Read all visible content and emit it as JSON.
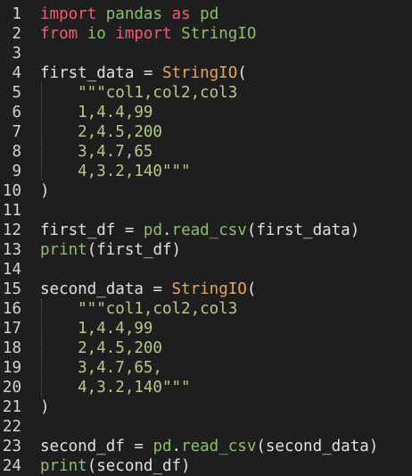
{
  "editor": {
    "language": "python",
    "colors": {
      "background": "#1e1e1e",
      "keyword": "#f05a78",
      "module": "#8fbf6a",
      "class": "#e5a560",
      "string": "#b8c98a",
      "text": "#e0e0e0"
    },
    "lines": [
      {
        "num": "1",
        "tokens": [
          {
            "t": "import",
            "c": "kw"
          },
          {
            "t": " ",
            "c": "op"
          },
          {
            "t": "pandas",
            "c": "mod"
          },
          {
            "t": " ",
            "c": "op"
          },
          {
            "t": "as",
            "c": "kw"
          },
          {
            "t": " ",
            "c": "op"
          },
          {
            "t": "pd",
            "c": "mod"
          }
        ]
      },
      {
        "num": "2",
        "tokens": [
          {
            "t": "from",
            "c": "kw"
          },
          {
            "t": " ",
            "c": "op"
          },
          {
            "t": "io",
            "c": "mod"
          },
          {
            "t": " ",
            "c": "op"
          },
          {
            "t": "import",
            "c": "kw"
          },
          {
            "t": " ",
            "c": "op"
          },
          {
            "t": "StringIO",
            "c": "mod"
          }
        ]
      },
      {
        "num": "3",
        "tokens": []
      },
      {
        "num": "4",
        "tokens": [
          {
            "t": "first_data",
            "c": "var"
          },
          {
            "t": " = ",
            "c": "op"
          },
          {
            "t": "StringIO",
            "c": "cls"
          },
          {
            "t": "(",
            "c": "op"
          }
        ]
      },
      {
        "num": "5",
        "tokens": [
          {
            "t": "    \"\"\"col1,col2,col3",
            "c": "str"
          }
        ]
      },
      {
        "num": "6",
        "tokens": [
          {
            "t": "    1,4.4,99",
            "c": "str"
          }
        ]
      },
      {
        "num": "7",
        "tokens": [
          {
            "t": "    2,4.5,200",
            "c": "str"
          }
        ]
      },
      {
        "num": "8",
        "tokens": [
          {
            "t": "    3,4.7,65",
            "c": "str"
          }
        ]
      },
      {
        "num": "9",
        "tokens": [
          {
            "t": "    4,3.2,140\"\"\"",
            "c": "str"
          }
        ]
      },
      {
        "num": "10",
        "tokens": [
          {
            "t": ")",
            "c": "op"
          }
        ]
      },
      {
        "num": "11",
        "tokens": []
      },
      {
        "num": "12",
        "tokens": [
          {
            "t": "first_df",
            "c": "var"
          },
          {
            "t": " = ",
            "c": "op"
          },
          {
            "t": "pd",
            "c": "mod"
          },
          {
            "t": ".",
            "c": "op"
          },
          {
            "t": "read_csv",
            "c": "fn"
          },
          {
            "t": "(first_data)",
            "c": "op"
          }
        ]
      },
      {
        "num": "13",
        "tokens": [
          {
            "t": "print",
            "c": "fn"
          },
          {
            "t": "(first_df)",
            "c": "op"
          }
        ]
      },
      {
        "num": "14",
        "tokens": []
      },
      {
        "num": "15",
        "tokens": [
          {
            "t": "second_data",
            "c": "var"
          },
          {
            "t": " = ",
            "c": "op"
          },
          {
            "t": "StringIO",
            "c": "cls"
          },
          {
            "t": "(",
            "c": "op"
          }
        ]
      },
      {
        "num": "16",
        "tokens": [
          {
            "t": "    \"\"\"col1,col2,col3",
            "c": "str"
          }
        ]
      },
      {
        "num": "17",
        "tokens": [
          {
            "t": "    1,4.4,99",
            "c": "str"
          }
        ]
      },
      {
        "num": "18",
        "tokens": [
          {
            "t": "    2,4.5,200",
            "c": "str"
          }
        ]
      },
      {
        "num": "19",
        "tokens": [
          {
            "t": "    3,4.7,65,",
            "c": "str"
          }
        ]
      },
      {
        "num": "20",
        "tokens": [
          {
            "t": "    4,3.2,140\"\"\"",
            "c": "str"
          }
        ]
      },
      {
        "num": "21",
        "tokens": [
          {
            "t": ")",
            "c": "op"
          }
        ]
      },
      {
        "num": "22",
        "tokens": []
      },
      {
        "num": "23",
        "tokens": [
          {
            "t": "second_df",
            "c": "var"
          },
          {
            "t": " = ",
            "c": "op"
          },
          {
            "t": "pd",
            "c": "mod"
          },
          {
            "t": ".",
            "c": "op"
          },
          {
            "t": "read_csv",
            "c": "fn"
          },
          {
            "t": "(second_data)",
            "c": "op"
          }
        ]
      },
      {
        "num": "24",
        "tokens": [
          {
            "t": "print",
            "c": "fn"
          },
          {
            "t": "(second_df)",
            "c": "op"
          }
        ]
      }
    ]
  }
}
